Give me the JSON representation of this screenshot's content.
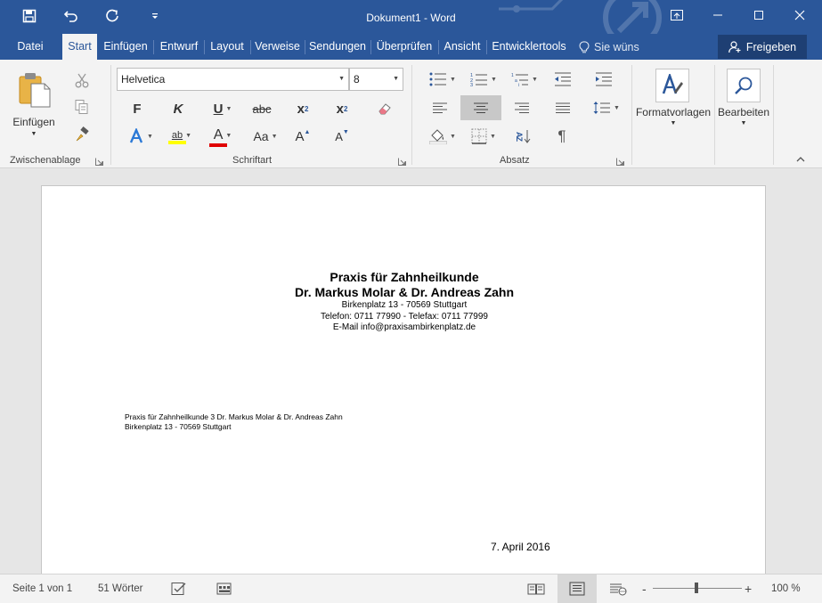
{
  "window": {
    "title": "Dokument1 - Word"
  },
  "tabs": [
    {
      "label": "Datei",
      "active": false
    },
    {
      "label": "Start",
      "active": true
    },
    {
      "label": "Einfügen",
      "active": false
    },
    {
      "label": "Entwurf",
      "active": false
    },
    {
      "label": "Layout",
      "active": false
    },
    {
      "label": "Verweise",
      "active": false
    },
    {
      "label": "Sendungen",
      "active": false
    },
    {
      "label": "Überprüfen",
      "active": false
    },
    {
      "label": "Ansicht",
      "active": false
    },
    {
      "label": "Entwicklertools",
      "active": false
    }
  ],
  "tellme": {
    "placeholder": "Sie wüns"
  },
  "share": {
    "label": "Freigeben"
  },
  "ribbon": {
    "clipboard": {
      "paste_label": "Einfügen",
      "group_label": "Zwischenablage"
    },
    "font": {
      "font_name": "Helvetica",
      "font_size": "8",
      "bold": "F",
      "italic": "K",
      "underline": "U",
      "strike": "abc",
      "subscript": "x",
      "subscript_mark": "2",
      "superscript": "x",
      "superscript_mark": "2",
      "highlight": "ab",
      "font_color": "A",
      "case": "Aa",
      "grow": "A",
      "shrink": "A",
      "group_label": "Schriftart",
      "highlight_color": "#ffff00",
      "font_color_value": "#e00000"
    },
    "paragraph": {
      "sort_letters": "AZ",
      "pilcrow": "¶",
      "group_label": "Absatz"
    },
    "styles": {
      "label": "Formatvorlagen"
    },
    "editing": {
      "label": "Bearbeiten"
    }
  },
  "document": {
    "header": {
      "line1": "Praxis für Zahnheilkunde",
      "line2": "Dr. Markus Molar & Dr. Andreas Zahn",
      "line3": "Birkenplatz 13 - 70569 Stuttgart",
      "line4": "Telefon: 0711 77990 - Telefax: 0711 77999",
      "line5": "E-Mail info@praxisambirkenplatz.de"
    },
    "sender": {
      "line1": "Praxis für Zahnheilkunde 3 Dr. Markus Molar & Dr. Andreas Zahn",
      "line2": "Birkenplatz 13 - 70569 Stuttgart"
    },
    "date": "7. April 2016"
  },
  "status": {
    "page": "Seite 1 von 1",
    "words": "51 Wörter",
    "zoom_minus": "-",
    "zoom_plus": "+",
    "zoom": "100 %",
    "zoom_level": 100
  },
  "colors": {
    "accent": "#2b579a",
    "accent_dark": "#1e3f73",
    "ribbon_bg": "#f3f3f3"
  }
}
